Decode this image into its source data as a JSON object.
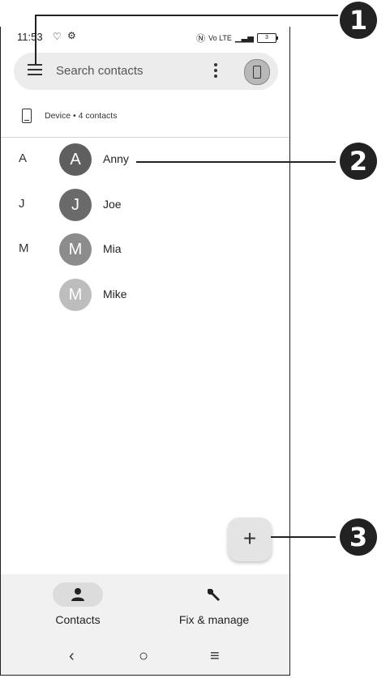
{
  "status_bar": {
    "time": "11:53",
    "right_text": "Vo LTE",
    "battery": "3"
  },
  "search": {
    "placeholder": "Search contacts"
  },
  "account": {
    "label": "Device • 4 contacts"
  },
  "contacts": [
    {
      "section": "A",
      "initial": "A",
      "name": "Anny",
      "color": "#5f5f5f"
    },
    {
      "section": "J",
      "initial": "J",
      "name": "Joe",
      "color": "#6a6a6a"
    },
    {
      "section": "M",
      "initial": "M",
      "name": "Mia",
      "color": "#8c8c8c"
    },
    {
      "section": "",
      "initial": "M",
      "name": "Mike",
      "color": "#bdbdbd"
    }
  ],
  "fab": {
    "symbol": "+"
  },
  "bottom_nav": {
    "items": [
      {
        "label": "Contacts",
        "icon": "person-icon",
        "selected": true
      },
      {
        "label": "Fix & manage",
        "icon": "wrench-icon",
        "selected": false
      }
    ]
  },
  "system_nav": {
    "back": "‹",
    "home": "○",
    "recents": "≡"
  },
  "callouts": [
    "1",
    "2",
    "3"
  ]
}
